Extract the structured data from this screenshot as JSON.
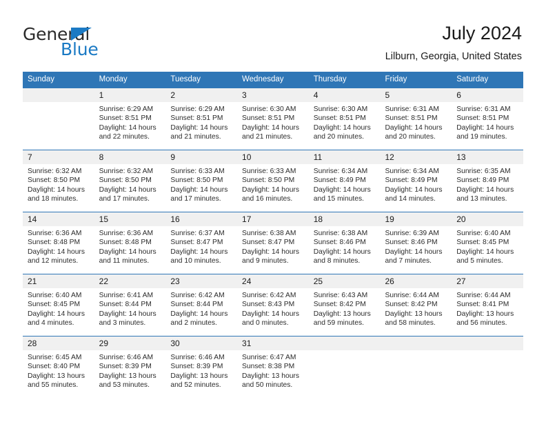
{
  "brand": {
    "name_top": "General",
    "name_bottom": "Blue",
    "accent_color": "#1b7ac4"
  },
  "header": {
    "title": "July 2024",
    "location": "Lilburn, Georgia, United States"
  },
  "theme": {
    "header_blue": "#2f76b6",
    "daynum_band": "#f0f0f0",
    "text": "#2b2b2b"
  },
  "weekday_headers": [
    "Sunday",
    "Monday",
    "Tuesday",
    "Wednesday",
    "Thursday",
    "Friday",
    "Saturday"
  ],
  "weeks": [
    [
      {
        "day": "",
        "sunrise": "",
        "sunset": "",
        "daylight_line1": "",
        "daylight_line2": "",
        "empty": true
      },
      {
        "day": "1",
        "sunrise": "Sunrise: 6:29 AM",
        "sunset": "Sunset: 8:51 PM",
        "daylight_line1": "Daylight: 14 hours",
        "daylight_line2": "and 22 minutes."
      },
      {
        "day": "2",
        "sunrise": "Sunrise: 6:29 AM",
        "sunset": "Sunset: 8:51 PM",
        "daylight_line1": "Daylight: 14 hours",
        "daylight_line2": "and 21 minutes."
      },
      {
        "day": "3",
        "sunrise": "Sunrise: 6:30 AM",
        "sunset": "Sunset: 8:51 PM",
        "daylight_line1": "Daylight: 14 hours",
        "daylight_line2": "and 21 minutes."
      },
      {
        "day": "4",
        "sunrise": "Sunrise: 6:30 AM",
        "sunset": "Sunset: 8:51 PM",
        "daylight_line1": "Daylight: 14 hours",
        "daylight_line2": "and 20 minutes."
      },
      {
        "day": "5",
        "sunrise": "Sunrise: 6:31 AM",
        "sunset": "Sunset: 8:51 PM",
        "daylight_line1": "Daylight: 14 hours",
        "daylight_line2": "and 20 minutes."
      },
      {
        "day": "6",
        "sunrise": "Sunrise: 6:31 AM",
        "sunset": "Sunset: 8:51 PM",
        "daylight_line1": "Daylight: 14 hours",
        "daylight_line2": "and 19 minutes."
      }
    ],
    [
      {
        "day": "7",
        "sunrise": "Sunrise: 6:32 AM",
        "sunset": "Sunset: 8:50 PM",
        "daylight_line1": "Daylight: 14 hours",
        "daylight_line2": "and 18 minutes."
      },
      {
        "day": "8",
        "sunrise": "Sunrise: 6:32 AM",
        "sunset": "Sunset: 8:50 PM",
        "daylight_line1": "Daylight: 14 hours",
        "daylight_line2": "and 17 minutes."
      },
      {
        "day": "9",
        "sunrise": "Sunrise: 6:33 AM",
        "sunset": "Sunset: 8:50 PM",
        "daylight_line1": "Daylight: 14 hours",
        "daylight_line2": "and 17 minutes."
      },
      {
        "day": "10",
        "sunrise": "Sunrise: 6:33 AM",
        "sunset": "Sunset: 8:50 PM",
        "daylight_line1": "Daylight: 14 hours",
        "daylight_line2": "and 16 minutes."
      },
      {
        "day": "11",
        "sunrise": "Sunrise: 6:34 AM",
        "sunset": "Sunset: 8:49 PM",
        "daylight_line1": "Daylight: 14 hours",
        "daylight_line2": "and 15 minutes."
      },
      {
        "day": "12",
        "sunrise": "Sunrise: 6:34 AM",
        "sunset": "Sunset: 8:49 PM",
        "daylight_line1": "Daylight: 14 hours",
        "daylight_line2": "and 14 minutes."
      },
      {
        "day": "13",
        "sunrise": "Sunrise: 6:35 AM",
        "sunset": "Sunset: 8:49 PM",
        "daylight_line1": "Daylight: 14 hours",
        "daylight_line2": "and 13 minutes."
      }
    ],
    [
      {
        "day": "14",
        "sunrise": "Sunrise: 6:36 AM",
        "sunset": "Sunset: 8:48 PM",
        "daylight_line1": "Daylight: 14 hours",
        "daylight_line2": "and 12 minutes."
      },
      {
        "day": "15",
        "sunrise": "Sunrise: 6:36 AM",
        "sunset": "Sunset: 8:48 PM",
        "daylight_line1": "Daylight: 14 hours",
        "daylight_line2": "and 11 minutes."
      },
      {
        "day": "16",
        "sunrise": "Sunrise: 6:37 AM",
        "sunset": "Sunset: 8:47 PM",
        "daylight_line1": "Daylight: 14 hours",
        "daylight_line2": "and 10 minutes."
      },
      {
        "day": "17",
        "sunrise": "Sunrise: 6:38 AM",
        "sunset": "Sunset: 8:47 PM",
        "daylight_line1": "Daylight: 14 hours",
        "daylight_line2": "and 9 minutes."
      },
      {
        "day": "18",
        "sunrise": "Sunrise: 6:38 AM",
        "sunset": "Sunset: 8:46 PM",
        "daylight_line1": "Daylight: 14 hours",
        "daylight_line2": "and 8 minutes."
      },
      {
        "day": "19",
        "sunrise": "Sunrise: 6:39 AM",
        "sunset": "Sunset: 8:46 PM",
        "daylight_line1": "Daylight: 14 hours",
        "daylight_line2": "and 7 minutes."
      },
      {
        "day": "20",
        "sunrise": "Sunrise: 6:40 AM",
        "sunset": "Sunset: 8:45 PM",
        "daylight_line1": "Daylight: 14 hours",
        "daylight_line2": "and 5 minutes."
      }
    ],
    [
      {
        "day": "21",
        "sunrise": "Sunrise: 6:40 AM",
        "sunset": "Sunset: 8:45 PM",
        "daylight_line1": "Daylight: 14 hours",
        "daylight_line2": "and 4 minutes."
      },
      {
        "day": "22",
        "sunrise": "Sunrise: 6:41 AM",
        "sunset": "Sunset: 8:44 PM",
        "daylight_line1": "Daylight: 14 hours",
        "daylight_line2": "and 3 minutes."
      },
      {
        "day": "23",
        "sunrise": "Sunrise: 6:42 AM",
        "sunset": "Sunset: 8:44 PM",
        "daylight_line1": "Daylight: 14 hours",
        "daylight_line2": "and 2 minutes."
      },
      {
        "day": "24",
        "sunrise": "Sunrise: 6:42 AM",
        "sunset": "Sunset: 8:43 PM",
        "daylight_line1": "Daylight: 14 hours",
        "daylight_line2": "and 0 minutes."
      },
      {
        "day": "25",
        "sunrise": "Sunrise: 6:43 AM",
        "sunset": "Sunset: 8:42 PM",
        "daylight_line1": "Daylight: 13 hours",
        "daylight_line2": "and 59 minutes."
      },
      {
        "day": "26",
        "sunrise": "Sunrise: 6:44 AM",
        "sunset": "Sunset: 8:42 PM",
        "daylight_line1": "Daylight: 13 hours",
        "daylight_line2": "and 58 minutes."
      },
      {
        "day": "27",
        "sunrise": "Sunrise: 6:44 AM",
        "sunset": "Sunset: 8:41 PM",
        "daylight_line1": "Daylight: 13 hours",
        "daylight_line2": "and 56 minutes."
      }
    ],
    [
      {
        "day": "28",
        "sunrise": "Sunrise: 6:45 AM",
        "sunset": "Sunset: 8:40 PM",
        "daylight_line1": "Daylight: 13 hours",
        "daylight_line2": "and 55 minutes."
      },
      {
        "day": "29",
        "sunrise": "Sunrise: 6:46 AM",
        "sunset": "Sunset: 8:39 PM",
        "daylight_line1": "Daylight: 13 hours",
        "daylight_line2": "and 53 minutes."
      },
      {
        "day": "30",
        "sunrise": "Sunrise: 6:46 AM",
        "sunset": "Sunset: 8:39 PM",
        "daylight_line1": "Daylight: 13 hours",
        "daylight_line2": "and 52 minutes."
      },
      {
        "day": "31",
        "sunrise": "Sunrise: 6:47 AM",
        "sunset": "Sunset: 8:38 PM",
        "daylight_line1": "Daylight: 13 hours",
        "daylight_line2": "and 50 minutes."
      },
      {
        "day": "",
        "sunrise": "",
        "sunset": "",
        "daylight_line1": "",
        "daylight_line2": "",
        "empty": true
      },
      {
        "day": "",
        "sunrise": "",
        "sunset": "",
        "daylight_line1": "",
        "daylight_line2": "",
        "empty": true
      },
      {
        "day": "",
        "sunrise": "",
        "sunset": "",
        "daylight_line1": "",
        "daylight_line2": "",
        "empty": true
      }
    ]
  ]
}
